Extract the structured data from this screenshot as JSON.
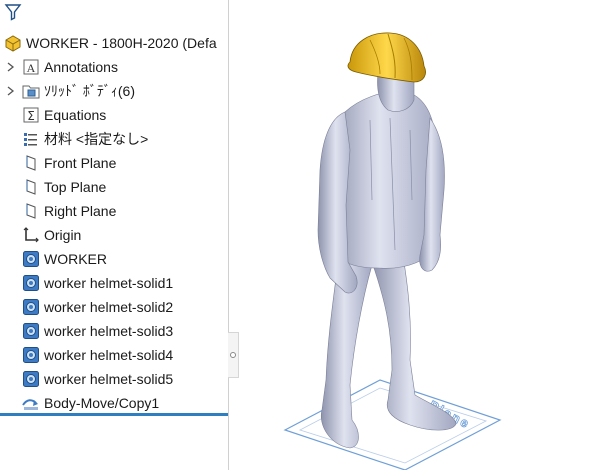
{
  "tree": {
    "root": "WORKER - 1800H-2020  (Defa",
    "items": [
      {
        "label": "Annotations",
        "icon": "annotations-icon",
        "expandable": true
      },
      {
        "label": "ｿﾘｯﾄﾞ ﾎﾞﾃﾞｨ(6)",
        "icon": "solid-bodies-folder-icon",
        "expandable": true
      },
      {
        "label": "Equations",
        "icon": "equations-icon",
        "expandable": false
      },
      {
        "label": "材料 <指定なし>",
        "icon": "material-icon",
        "expandable": false
      },
      {
        "label": "Front Plane",
        "icon": "plane-icon",
        "expandable": false
      },
      {
        "label": "Top Plane",
        "icon": "plane-icon",
        "expandable": false
      },
      {
        "label": "Right Plane",
        "icon": "plane-icon",
        "expandable": false
      },
      {
        "label": "Origin",
        "icon": "origin-icon",
        "expandable": false
      },
      {
        "label": "WORKER",
        "icon": "imported-body-icon",
        "expandable": false
      },
      {
        "label": "worker helmet-solid1",
        "icon": "imported-body-icon",
        "expandable": false
      },
      {
        "label": "worker helmet-solid2",
        "icon": "imported-body-icon",
        "expandable": false
      },
      {
        "label": "worker helmet-solid3",
        "icon": "imported-body-icon",
        "expandable": false
      },
      {
        "label": "worker helmet-solid4",
        "icon": "imported-body-icon",
        "expandable": false
      },
      {
        "label": "worker helmet-solid5",
        "icon": "imported-body-icon",
        "expandable": false
      },
      {
        "label": "Body-Move/Copy1",
        "icon": "move-copy-icon",
        "expandable": false
      }
    ]
  },
  "viewport": {
    "plane_label": "Plane",
    "colors": {
      "body": "#c2c6da",
      "helmet": "#f0c419",
      "plane": "#6f9fd8"
    }
  }
}
